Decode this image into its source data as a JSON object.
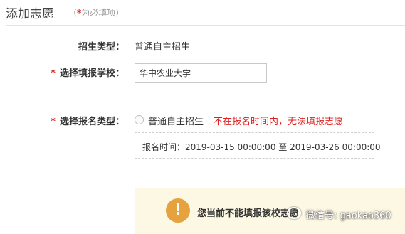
{
  "header": {
    "title": "添加志愿",
    "note_open": "（",
    "note_star": "*",
    "note_text": "为必填项）"
  },
  "form": {
    "admission_type": {
      "label": "招生类型：",
      "value": "普通自主招生"
    },
    "school": {
      "required_mark": "*",
      "label": "选择填报学校：",
      "value": "华中农业大学"
    },
    "apply_type": {
      "required_mark": "*",
      "label": "选择报名类型：",
      "option_label": "普通自主招生",
      "option_selected": false,
      "error": "不在报名时间内，无法填报志愿",
      "time_text": "报名时间：2019-03-15 00:00:00 至 2019-03-26 00:00:00"
    }
  },
  "alert": {
    "icon": "!",
    "text": "您当前不能填报该校志愿"
  },
  "watermark": {
    "text": "微信号: gaokao360"
  },
  "colors": {
    "required": "#e02020",
    "error": "#e02020",
    "alert_bg": "#fcf8e3",
    "alert_icon": "#e6a23c"
  }
}
